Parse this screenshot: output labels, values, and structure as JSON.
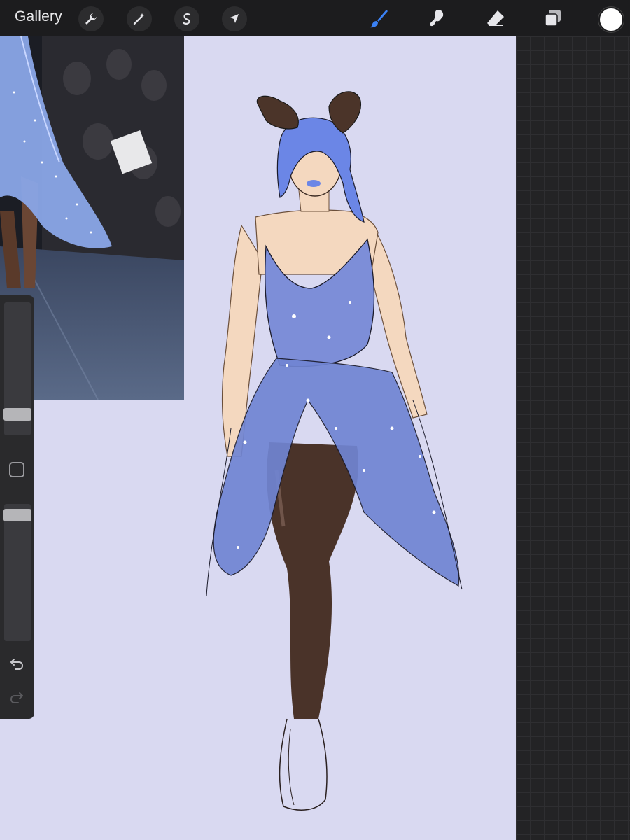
{
  "toolbar": {
    "gallery_label": "Gallery",
    "actions_icon": "wrench-icon",
    "adjustments_icon": "magic-wand-icon",
    "selection_icon": "selection-s-icon",
    "transform_icon": "arrow-cursor-icon",
    "brush_icon": "brush-icon",
    "smudge_icon": "smudge-icon",
    "eraser_icon": "eraser-icon",
    "layers_icon": "layers-icon",
    "active_tool": "brush",
    "current_color": "#ffffff"
  },
  "sidebar": {
    "brush_size_level": 0.88,
    "opacity_level": 0.04,
    "modifier_icon": "square-modifier-icon",
    "undo_icon": "undo-icon",
    "redo_icon": "redo-icon"
  },
  "colors": {
    "canvas_bg": "#d9d9f1",
    "accent_blue": "#3b82f6",
    "dress_blue": "#6f84d4",
    "hair_blue": "#6b86e6",
    "skin": "#f4d8bf",
    "tights": "#4a3329",
    "horns": "#4b3429"
  }
}
